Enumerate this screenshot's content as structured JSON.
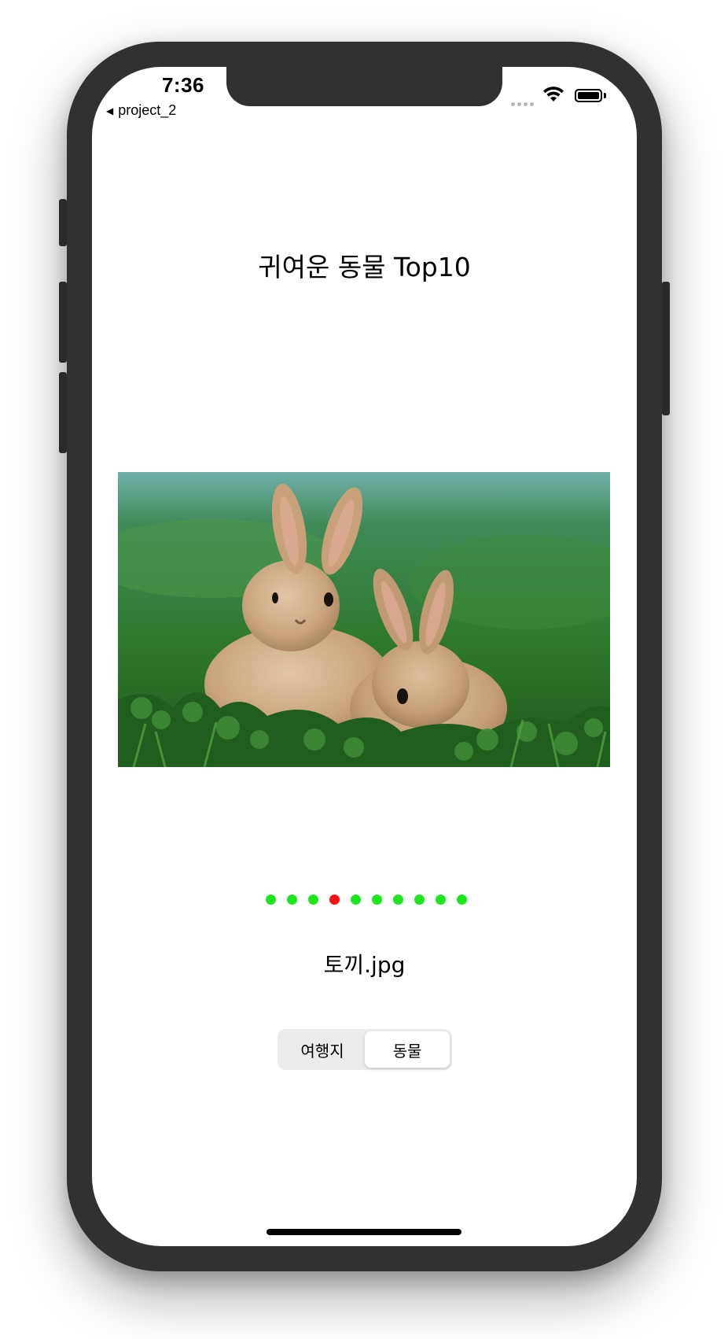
{
  "status_bar": {
    "time": "7:36",
    "back_label": "project_2",
    "back_arrow": "◀"
  },
  "main": {
    "title": "귀여운 동물 Top10",
    "photo_subject": "two rabbits in grass",
    "filename": "토끼.jpg"
  },
  "page_control": {
    "total": 10,
    "current_index": 3,
    "colors": {
      "inactive": "#1ee61e",
      "active": "#ff1010"
    }
  },
  "segmented_control": {
    "segments": [
      "여행지",
      "동물"
    ],
    "selected_index": 1
  },
  "icons": {
    "wifi": "wifi-icon",
    "battery": "battery-icon",
    "signal": "cellular-signal-icon",
    "back": "back-arrow-icon"
  }
}
